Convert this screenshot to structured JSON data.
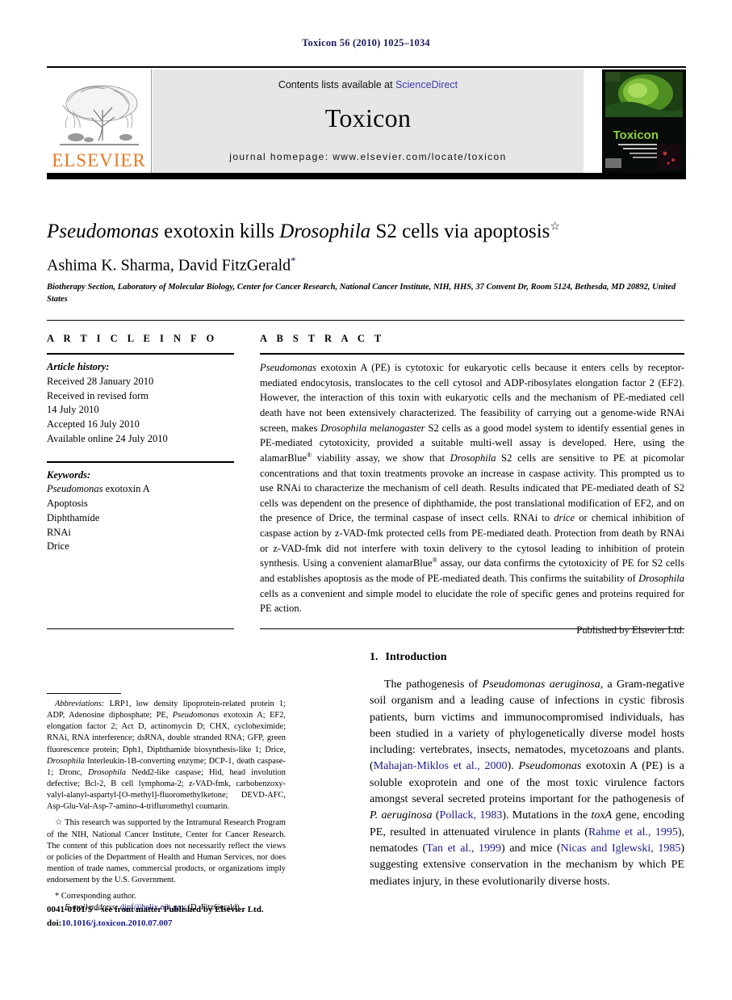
{
  "running_head": "Toxicon 56 (2010) 1025–1034",
  "journal_header": {
    "contents_prefix": "Contents lists available at ",
    "sciencedirect": "ScienceDirect",
    "journal_title": "Toxicon",
    "homepage": "journal homepage: www.elsevier.com/locate/toxicon",
    "publisher_logo_word": "ELSEVIER",
    "cover_title": "Toxicon"
  },
  "article": {
    "title_part1": "Pseudomonas",
    "title_part2": " exotoxin kills ",
    "title_part3": "Drosophila",
    "title_part4": " S2 cells via apoptosis",
    "title_marker": "☆",
    "authors": "Ashima K. Sharma, David FitzGerald",
    "author_marker": "*",
    "affiliation": "Biotherapy Section, Laboratory of Molecular Biology, Center for Cancer Research, National Cancer Institute, NIH, HHS, 37 Convent Dr, Room 5124, Bethesda, MD 20892, United States"
  },
  "article_info": {
    "heading": "A R T I C L E  I N F O",
    "history_label": "Article history:",
    "history": [
      "Received 28 January 2010",
      "Received in revised form",
      "14 July 2010",
      "Accepted 16 July 2010",
      "Available online 24 July 2010"
    ],
    "keywords_label": "Keywords:",
    "keywords": [
      "Pseudomonas exotoxin A",
      "Apoptosis",
      "Diphthamide",
      "RNAi",
      "Drice"
    ]
  },
  "abstract": {
    "heading": "A B S T R A C T",
    "text": "Pseudomonas exotoxin A (PE) is cytotoxic for eukaryotic cells because it enters cells by receptor-mediated endocytosis, translocates to the cell cytosol and ADP-ribosylates elongation factor 2 (EF2). However, the interaction of this toxin with eukaryotic cells and the mechanism of PE-mediated cell death have not been extensively characterized. The feasibility of carrying out a genome-wide RNAi screen, makes Drosophila melanogaster S2 cells as a good model system to identify essential genes in PE-mediated cytotoxicity, provided a suitable multi-well assay is developed. Here, using the alamarBlue® viability assay, we show that Drosophila S2 cells are sensitive to PE at picomolar concentrations and that toxin treatments provoke an increase in caspase activity. This prompted us to use RNAi to characterize the mechanism of cell death. Results indicated that PE-mediated death of S2 cells was dependent on the presence of diphthamide, the post translational modification of EF2, and on the presence of Drice, the terminal caspase of insect cells. RNAi to drice or chemical inhibition of caspase action by z-VAD-fmk protected cells from PE-mediated death. Protection from death by RNAi or z-VAD-fmk did not interfere with toxin delivery to the cytosol leading to inhibition of protein synthesis. Using a convenient alamarBlue® assay, our data confirms the cytotoxicity of PE for S2 cells and establishes apoptosis as the mode of PE-mediated death. This confirms the suitability of Drosophila cells as a convenient and simple model to elucidate the role of specific genes and proteins required for PE action.",
    "published_by": "Published by Elsevier Ltd."
  },
  "footnotes": {
    "abbreviations_label": "Abbreviations:",
    "abbreviations_text": "LRP1, low density lipoprotein-related protein 1; ADP, Adenosine diphosphate; PE, Pseudomonas exotoxin A; EF2, elongation factor 2; Act D, actinomycin D; CHX, cycloheximide; RNAi, RNA interference; dsRNA, double stranded RNA; GFP, green fluorescence protein; Dph1, Diphthamide biosynthesis-like 1; Drice, Drosophila interleukin-1B-converting enzyme; DCP-1, death caspase-1; Dronc, Drosophila Nedd2-like caspase; Hid, head involution defective; Bcl-2, B cell lymphoma-2; z-VAD-fmk, carbobenzoxy-valyl-alanyl-aspartyl-[O-methyl]-fluoromethylketone; DEVD-AFC, Asp-Glu-Val-Asp-7-amino-4-trifluromethyl coumarin.",
    "funding_marker": "☆",
    "funding_text": "This research was supported by the Intramural Research Program of the NIH, National Cancer Institute, Center for Cancer Research. The content of this publication does not necessarily reflect the views or policies of the Department of Health and Human Services, nor does mention of trade names, commercial products, or organizations imply endorsement by the U.S. Government.",
    "corresponding_marker": "*",
    "corresponding_text": "Corresponding author.",
    "email_label": "E-mail address:",
    "email": "djpf@helix.nih.gov",
    "email_suffix": "(D. FitzGerald)"
  },
  "copyright": {
    "line1": "0041-0101/$ – see front matter Published by Elsevier Ltd.",
    "doi_label": "doi:",
    "doi": "10.1016/j.toxicon.2010.07.007"
  },
  "introduction": {
    "number": "1.",
    "heading": "Introduction",
    "paragraph_segments": [
      {
        "t": "The pathogenesis of ",
        "style": "normal"
      },
      {
        "t": "Pseudomonas aeruginosa",
        "style": "italic"
      },
      {
        "t": ", a Gram-negative soil organism and a leading cause of infections in cystic fibrosis patients, burn victims and immunocompromised individuals, has been studied in a variety of phylogenetically diverse model hosts including: vertebrates, insects, nematodes, mycetozoans and plants. (",
        "style": "normal"
      },
      {
        "t": "Mahajan-Miklos et al., 2000",
        "style": "cite"
      },
      {
        "t": "). ",
        "style": "normal"
      },
      {
        "t": "Pseudomonas",
        "style": "italic"
      },
      {
        "t": " exotoxin A (PE) is a soluble exoprotein and one of the most toxic virulence factors amongst several secreted proteins important for the pathogenesis of ",
        "style": "normal"
      },
      {
        "t": "P. aeruginosa",
        "style": "italic"
      },
      {
        "t": " (",
        "style": "normal"
      },
      {
        "t": "Pollack, 1983",
        "style": "cite"
      },
      {
        "t": "). Mutations in the ",
        "style": "normal"
      },
      {
        "t": "toxA",
        "style": "italic"
      },
      {
        "t": " gene, encoding PE, resulted in attenuated virulence in plants (",
        "style": "normal"
      },
      {
        "t": "Rahme et al., 1995",
        "style": "cite"
      },
      {
        "t": "), nematodes (",
        "style": "normal"
      },
      {
        "t": "Tan et al., 1999",
        "style": "cite"
      },
      {
        "t": ") and mice (",
        "style": "normal"
      },
      {
        "t": "Nicas and Iglewski, 1985",
        "style": "cite"
      },
      {
        "t": ") suggesting extensive conservation in the mechanism by which PE mediates injury, in these evolutionarily diverse hosts.",
        "style": "normal"
      }
    ]
  },
  "colors": {
    "elsevier_orange": "#E87722",
    "link_blue": "#1a1a8e",
    "sciencedirect_blue": "#3c3cae",
    "header_grey": "#e6e6e6"
  }
}
